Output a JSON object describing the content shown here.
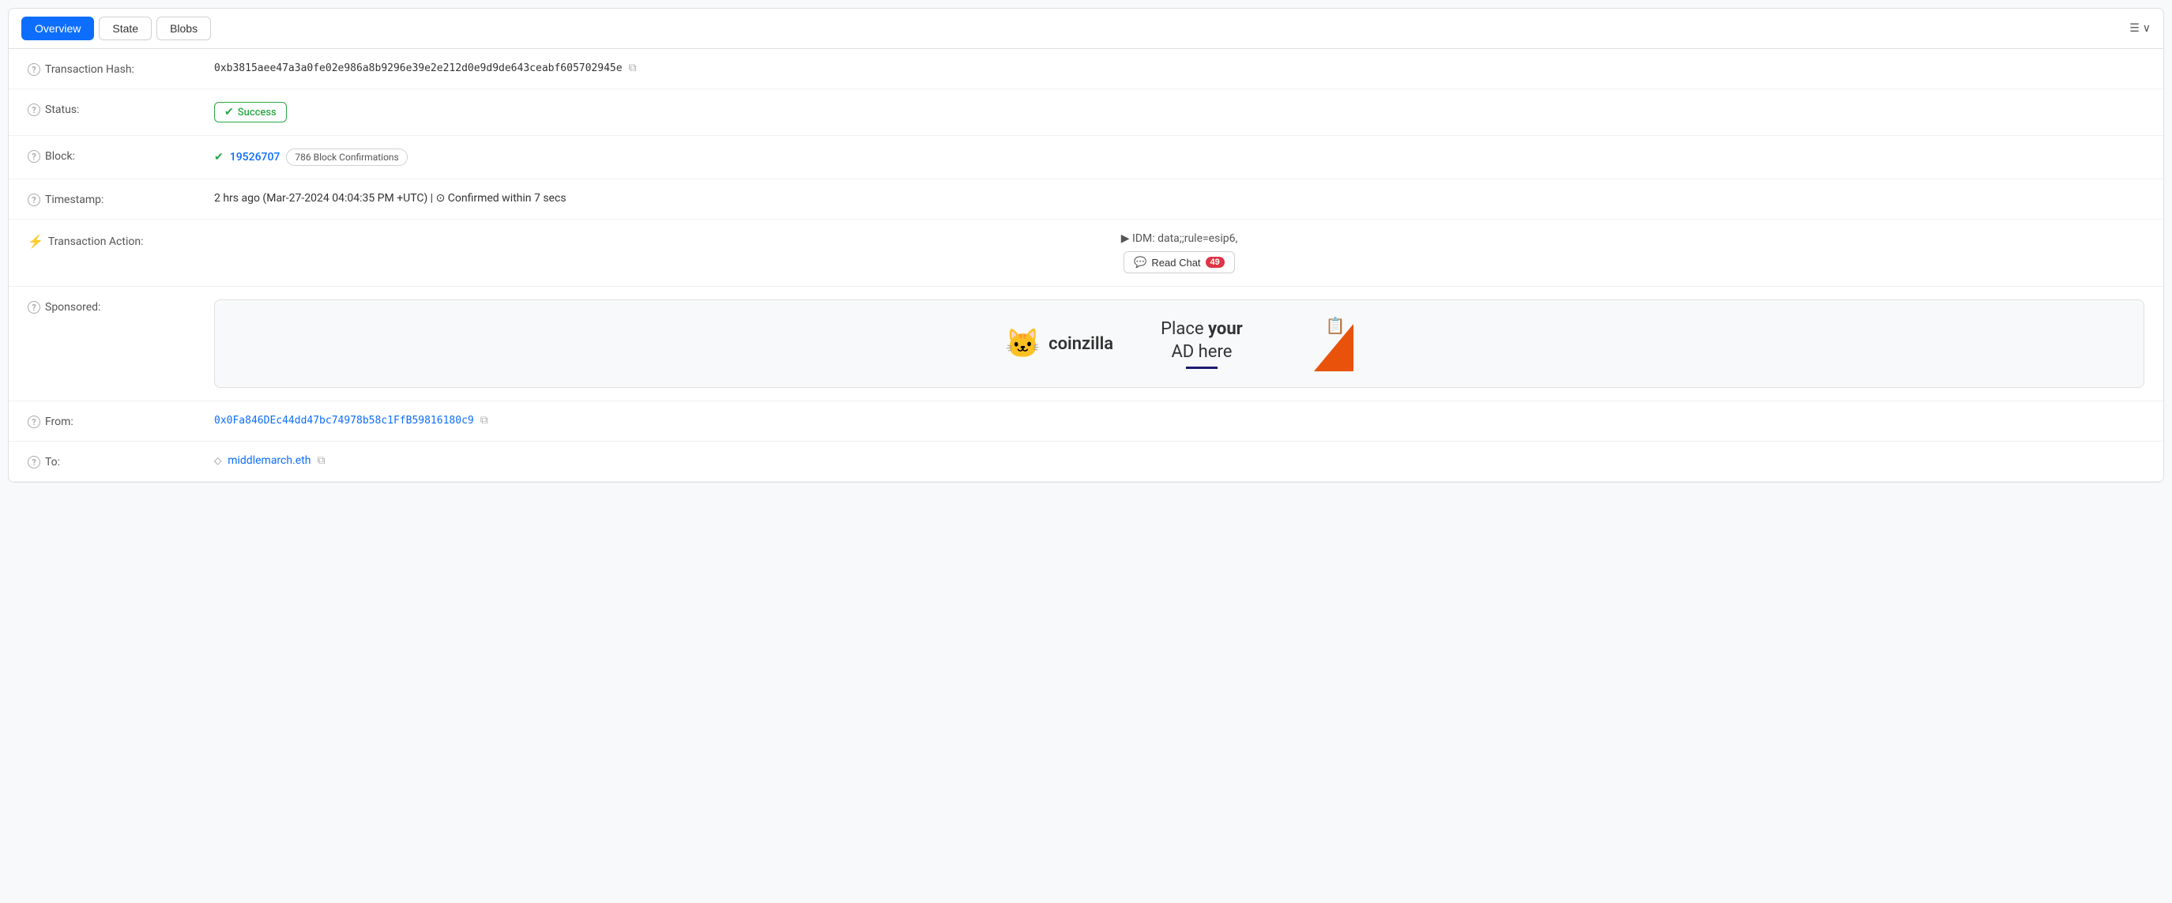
{
  "tabs": {
    "items": [
      {
        "label": "Overview",
        "active": true
      },
      {
        "label": "State",
        "active": false
      },
      {
        "label": "Blobs",
        "active": false
      }
    ],
    "right_label": "≡ ∨"
  },
  "transaction": {
    "hash": {
      "label": "Transaction Hash:",
      "value": "0xb3815aee47a3a0fe02e986a8b9296e39e2e212d0e9d9de643ceabf605702945e"
    },
    "status": {
      "label": "Status:",
      "value": "Success"
    },
    "block": {
      "label": "Block:",
      "number": "19526707",
      "confirmations": "786 Block Confirmations"
    },
    "timestamp": {
      "label": "Timestamp:",
      "value": "2 hrs ago (Mar-27-2024 04:04:35 PM +UTC) | ⊙ Confirmed within 7 secs"
    },
    "transaction_action": {
      "label": "Transaction Action:",
      "text": "▶ IDM: data;;rule=esip6,",
      "button_label": "Read Chat",
      "badge_count": "49"
    },
    "sponsored": {
      "label": "Sponsored:",
      "logo_text": "coinzilla",
      "ad_line1": "Place ",
      "ad_bold": "your",
      "ad_line2": "AD here"
    },
    "from": {
      "label": "From:",
      "address": "0x0Fa846DEc44dd47bc74978b58c1FfB59816180c9"
    },
    "to": {
      "label": "To:",
      "address": "middlemarch.eth"
    }
  },
  "icons": {
    "help": "?",
    "copy": "⧉",
    "check": "✔",
    "clock": "⊙",
    "lightning": "⚡",
    "chat": "💬",
    "contract": "◇"
  }
}
